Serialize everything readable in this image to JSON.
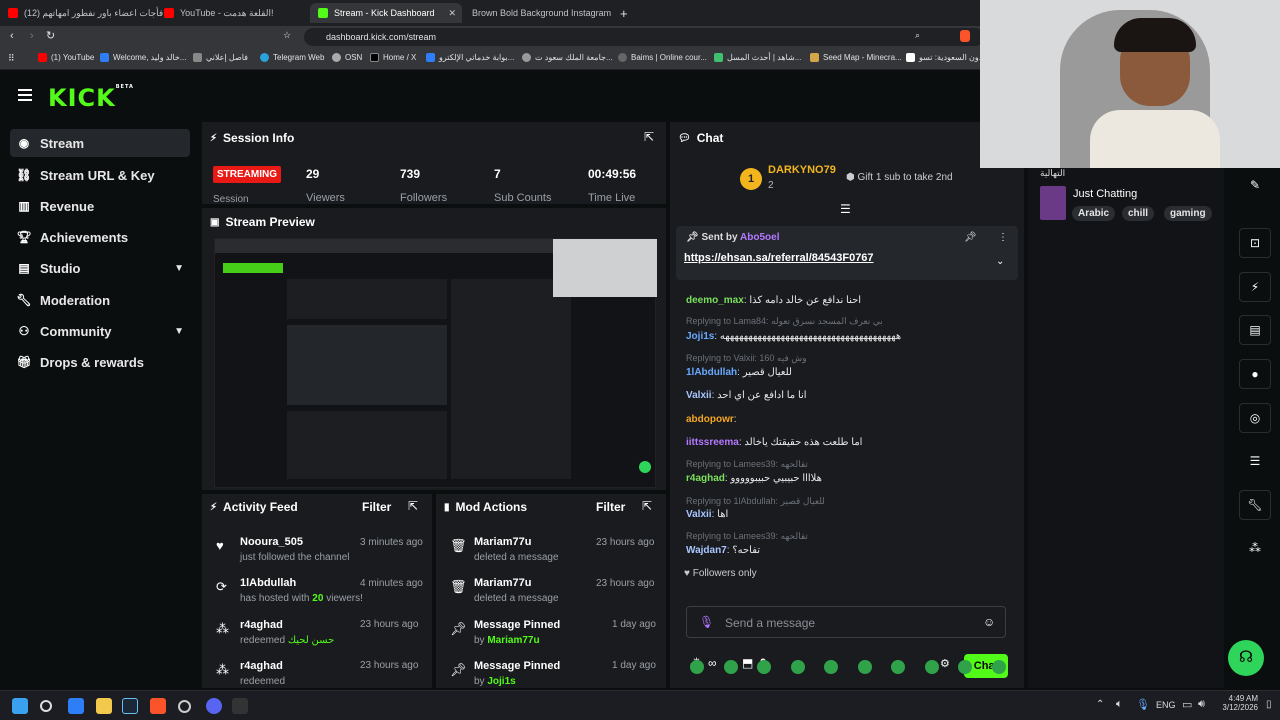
{
  "browser": {
    "tabs": [
      {
        "label": "(12) فأجات اعضاء باور نفطور امهاتهم"
      },
      {
        "label": "YouTube - القلعة هدمت!"
      },
      {
        "label": "Stream - Kick Dashboard"
      },
      {
        "label": "Brown Bold Background Instagram P"
      }
    ],
    "new_tab": "+",
    "url": "dashboard.kick.com/stream",
    "bookmarks": [
      "(1) YouTube",
      "Welcome, خالد وليد...",
      "فاصل إعلاني",
      "Telegram Web",
      "OSN",
      "Home / X",
      "بوابة خدماتي الإلكترو...",
      "جامعة الملك سعود ت...",
      "Baims | Online cour...",
      "شاهد | أحدث المسل...",
      "Seed Map - Minecra...",
      "ون السعودية: تسو..."
    ]
  },
  "app": {
    "logo": "KICK",
    "logo_badge": "BETA",
    "nav": [
      {
        "label": "Stream",
        "icon": "broadcast-icon"
      },
      {
        "label": "Stream URL & Key",
        "icon": "link-icon"
      },
      {
        "label": "Revenue",
        "icon": "chart-icon"
      },
      {
        "label": "Achievements",
        "icon": "trophy-icon"
      },
      {
        "label": "Studio",
        "icon": "studio-icon"
      },
      {
        "label": "Moderation",
        "icon": "wrench-icon"
      },
      {
        "label": "Community",
        "icon": "community-icon"
      },
      {
        "label": "Drops & rewards",
        "icon": "gift-icon"
      }
    ],
    "session": {
      "title": "Session Info",
      "status": "STREAMING",
      "status_sub": "Session",
      "stats": [
        {
          "value": "29",
          "label": "Viewers"
        },
        {
          "value": "739",
          "label": "Followers"
        },
        {
          "value": "7",
          "label": "Sub Counts"
        },
        {
          "value": "00:49:56",
          "label": "Time Live"
        }
      ]
    },
    "preview": {
      "title": "Stream Preview"
    },
    "activity": {
      "title": "Activity Feed",
      "filter": "Filter",
      "items": [
        {
          "name": "Nooura_505",
          "detail": "just followed the channel",
          "time": "3 minutes ago"
        },
        {
          "name": "1lAbdullah",
          "detail": "has hosted with",
          "count": "20",
          "detail2": "viewers!",
          "time": "4 minutes ago"
        },
        {
          "name": "r4aghad",
          "detail": "redeemed",
          "extra": "حسن لحيك",
          "time": "23 hours ago"
        },
        {
          "name": "r4aghad",
          "detail": "redeemed",
          "time": "23 hours ago"
        }
      ]
    },
    "mod": {
      "title": "Mod Actions",
      "filter": "Filter",
      "items": [
        {
          "name": "Mariam77u",
          "detail": "deleted a message",
          "time": "23 hours ago"
        },
        {
          "name": "Mariam77u",
          "detail": "deleted a message",
          "time": "23 hours ago"
        },
        {
          "name": "Message Pinned",
          "detail": "by",
          "by": "Mariam77u",
          "time": "1 day ago"
        },
        {
          "name": "Message Pinned",
          "detail": "by",
          "by": "Joji1s",
          "time": "1 day ago"
        }
      ]
    },
    "chat": {
      "title": "Chat",
      "leader_rank": "1",
      "leader_name": "DARKYNO79",
      "leader_count": "2",
      "gift_text": "Gift 1 sub to take 2nd",
      "pinned_by_label": "Sent by",
      "pinned_by": "Abo5oel",
      "pinned_link": "https://ehsan.sa/referral/84543F0767",
      "messages": [
        {
          "user": "deemo_max",
          "color": "#7be05a",
          "text": "احنا ندافع عن خالد دامه كذا"
        },
        {
          "reply": "Replying to Lama84: بي نعرف المسجد نسرق تعوله"
        },
        {
          "user": "Joji1s",
          "color": "#6aa9ff",
          "text": "ههههههههههههههههههههههههههههههههههههههه"
        },
        {
          "reply": "Replying to Valxii: وش فيه 160"
        },
        {
          "user": "1lAbdullah",
          "color": "#6aa9ff",
          "text": "للعيال قصير"
        },
        {
          "user": "Valxii",
          "color": "#a8c6ff",
          "text": "انا ما ادافع عن اي احد"
        },
        {
          "user": "abdopowr",
          "color": "#f5a623",
          "text": ""
        },
        {
          "user": "iittssreema",
          "color": "#b478ff",
          "text": "اما طلعت هذه حقيقتك ياخالد"
        },
        {
          "reply": "Replying to Lamees39: تقالحهه"
        },
        {
          "user": "r4aghad",
          "color": "#7be05a",
          "text": "هلاااا حبيبيي حبيبووووو"
        },
        {
          "reply": "Replying to 1lAbdullah: للعيال قصير"
        },
        {
          "user": "Valxii",
          "color": "#a8c6ff",
          "text": "اها"
        },
        {
          "reply": "Replying to Lamees39: تقالحهه"
        },
        {
          "user": "Wajdan7",
          "color": "#a8c6ff",
          "text": "تفاحه؟"
        }
      ],
      "followers_only": "Followers only",
      "placeholder": "Send a message",
      "points": "∞",
      "gift_count": "0",
      "send_label": "Chat"
    },
    "category": {
      "streamer_label": "التهالية",
      "name": "Just Chatting",
      "tags": [
        "Arabic",
        "chill",
        "gaming"
      ]
    }
  },
  "taskbar": {
    "lang": "ENG",
    "time": "4:49 AM",
    "date": "3/12/2026"
  },
  "colors": {
    "accent": "#53fc18",
    "streaming": "#e91916",
    "panel": "#191b1f",
    "bg": "#0b0e0f"
  }
}
